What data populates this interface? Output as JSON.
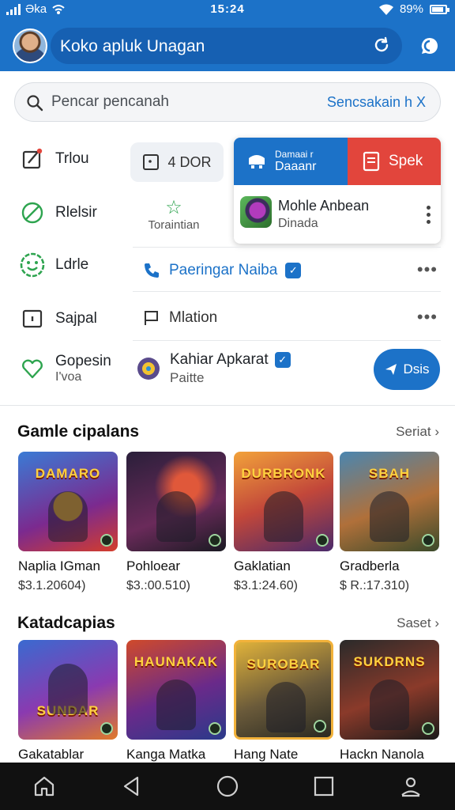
{
  "status_bar": {
    "left": "Əka",
    "time": "15:24",
    "battery": "89%"
  },
  "app_bar": {
    "title": "Koko apluk Unagan"
  },
  "search": {
    "placeholder": "Pencar pencanah",
    "action": "Sencsakain h X"
  },
  "menu": [
    {
      "label": "Trlou",
      "icon": "edit-icon"
    },
    {
      "label": "Rlelsir",
      "icon": "block-icon"
    },
    {
      "label": "Ldrle",
      "icon": "smile-icon"
    },
    {
      "label": "Sajpal",
      "icon": "square-icon"
    },
    {
      "label": "Gopesin",
      "sub": "I'voa",
      "icon": "heart-icon"
    }
  ],
  "chip": {
    "label": "4 DOR"
  },
  "star_block": {
    "label": "Toraintian"
  },
  "popup": {
    "blue_small": "Damaai r",
    "blue_main": "Daaanr",
    "red_label": "Spek",
    "app_name": "Mohle Anbean",
    "app_sub": "Dinada"
  },
  "rows": [
    {
      "label": "Paeringar Naiba"
    },
    {
      "label": "Mlation"
    }
  ],
  "kahiar": {
    "title": "Kahiar Apkarat",
    "sub": "Paitte"
  },
  "fab": {
    "label": "Dsis"
  },
  "sections": [
    {
      "title": "Gamle cipalans",
      "more": "Seriat",
      "items": [
        {
          "tile_text": "DAMARO",
          "name": "Naplia IGman",
          "price": "$3.1.20604)"
        },
        {
          "tile_text": "",
          "name": "Pohloear",
          "price": "$3.:00.510)"
        },
        {
          "tile_text": "DURBRONK",
          "name": "Gaklatian",
          "price": "$3.1:24.60)"
        },
        {
          "tile_text": "SBAH",
          "name": "Gradberla",
          "price": "$ R.:17.310)"
        }
      ]
    },
    {
      "title": "Katadcapias",
      "more": "Saset",
      "items": [
        {
          "tile_text": "SUNDAR",
          "name": "Gakatablar"
        },
        {
          "tile_text": "HAUNAKAK",
          "name": "Kanga Matka"
        },
        {
          "tile_text": "SUROBAR",
          "name": "Hang Nate"
        },
        {
          "tile_text": "SUKDRNS",
          "name": "Hackn Nanola"
        }
      ]
    }
  ],
  "colors": {
    "primary": "#1c72c8",
    "danger": "#e2453c",
    "accent_green": "#2ea44f"
  },
  "nav": [
    "home-icon",
    "back-icon",
    "circle-home-icon",
    "recents-icon",
    "person-icon"
  ]
}
